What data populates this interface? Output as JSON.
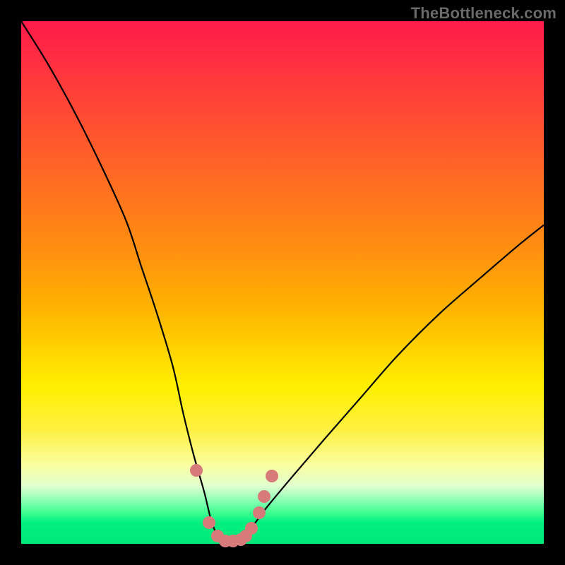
{
  "watermark": "TheBottleneck.com",
  "colors": {
    "background": "#000000",
    "curve": "#000000",
    "marker": "#d77b7a",
    "watermark_text": "#6a6a6a"
  },
  "chart_data": {
    "type": "line",
    "title": "",
    "xlabel": "",
    "ylabel": "",
    "xlim": [
      0,
      100
    ],
    "ylim": [
      0,
      100
    ],
    "grid": false,
    "legend": false,
    "series": [
      {
        "name": "bottleneck-curve",
        "x": [
          0,
          5,
          10,
          15,
          20,
          23,
          26,
          29,
          31,
          33,
          35,
          36.5,
          38,
          40,
          42,
          44,
          47,
          52,
          58,
          65,
          72,
          80,
          88,
          95,
          100
        ],
        "y": [
          100,
          92,
          83,
          73,
          62,
          53,
          44,
          34,
          25,
          17,
          10,
          4,
          1,
          0,
          1,
          3,
          7,
          13,
          20,
          28,
          36,
          44,
          51,
          57,
          61
        ]
      }
    ],
    "markers": {
      "name": "highlight-points",
      "x": [
        33.5,
        36,
        37.5,
        39,
        40.5,
        42,
        43,
        44,
        45.5,
        46.5,
        48
      ],
      "y": [
        14,
        4,
        1.5,
        0.5,
        0.5,
        0.8,
        1.5,
        3,
        6,
        9,
        13
      ]
    },
    "gradient_stops": [
      {
        "pos": 0,
        "color": "#ff1a4a"
      },
      {
        "pos": 20,
        "color": "#ff5030"
      },
      {
        "pos": 44,
        "color": "#ff9010"
      },
      {
        "pos": 62,
        "color": "#ffd000"
      },
      {
        "pos": 78,
        "color": "#fff040"
      },
      {
        "pos": 92,
        "color": "#80ffb0"
      },
      {
        "pos": 100,
        "color": "#00e878"
      }
    ]
  }
}
